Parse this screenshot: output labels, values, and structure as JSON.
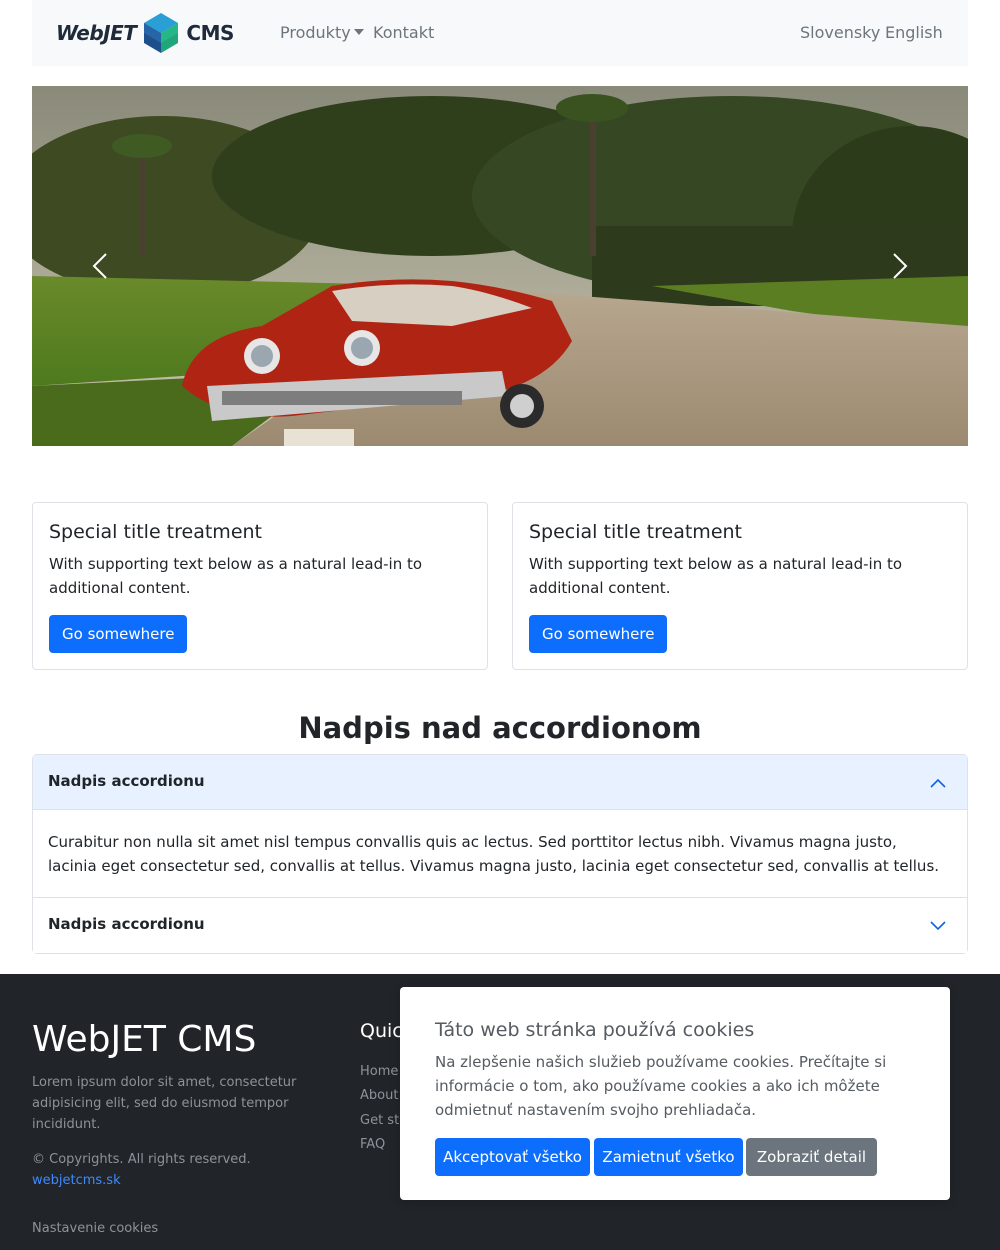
{
  "nav": {
    "logo": {
      "left_text": "WebJET",
      "right_text": "CMS"
    },
    "items": [
      {
        "label": "Produkty",
        "dropdown": true
      },
      {
        "label": "Kontakt",
        "dropdown": false
      }
    ],
    "languages": [
      "Slovensky",
      "English"
    ]
  },
  "carousel": {
    "image": "vintage red convertible car on a dirt road with palm trees and forest",
    "prev_icon": "chevron-left-icon",
    "next_icon": "chevron-right-icon"
  },
  "cards": [
    {
      "title": "Special title treatment",
      "text": "With supporting text below as a natural lead-in to additional content.",
      "button": "Go somewhere"
    },
    {
      "title": "Special title treatment",
      "text": "With supporting text below as a natural lead-in to additional content.",
      "button": "Go somewhere"
    }
  ],
  "accordion": {
    "heading": "Nadpis nad accordionom",
    "items": [
      {
        "title": "Nadpis accordionu",
        "open": true,
        "body": "Curabitur non nulla sit amet nisl tempus convallis quis ac lectus. Sed porttitor lectus nibh. Vivamus magna justo, lacinia eget consectetur sed, convallis at tellus. Vivamus magna justo, lacinia eget consectetur sed, convallis at tellus."
      },
      {
        "title": "Nadpis accordionu",
        "open": false
      }
    ]
  },
  "footer": {
    "brand": "WebJET CMS",
    "description": "Lorem ipsum dolor sit amet, consectetur adipisicing elit, sed do eiusmod tempor incididunt.",
    "copyright": "© Copyrights. All rights reserved.",
    "link": "webjetcms.sk",
    "cookie_settings": "Nastavenie cookies",
    "quick_links": {
      "title_visible": "Quic",
      "items": [
        "Home",
        "About",
        "Get sta",
        "FAQ"
      ]
    }
  },
  "cookie_dialog": {
    "title": "Táto web stránka používá cookies",
    "text": "Na zlepšenie našich služieb používame cookies. Prečítajte si informácie o tom, ako používame cookies a ako ich môžete odmietnuť nastavením svojho prehliadača.",
    "accept": "Akceptovať všetko",
    "reject": "Zamietnuť všetko",
    "detail": "Zobraziť detail"
  },
  "colors": {
    "primary": "#0d6efd",
    "secondary": "#6c757d",
    "footer_bg": "#212529",
    "navbar_bg": "#f8f9fa",
    "accordion_active_bg": "#e7f1ff"
  }
}
